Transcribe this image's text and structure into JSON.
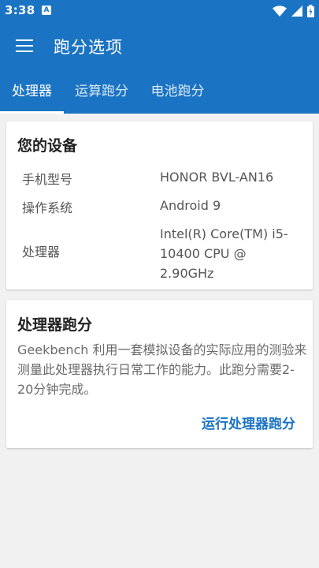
{
  "status_bar": {
    "time": "3:38",
    "notification_icon": "A",
    "icons": [
      "wifi-icon",
      "signal-icon",
      "battery-icon"
    ]
  },
  "app_bar": {
    "title": "跑分选项",
    "menu_icon": "hamburger-menu-icon"
  },
  "tabs": [
    {
      "label": "处理器",
      "active": true
    },
    {
      "label": "运算跑分",
      "active": false
    },
    {
      "label": "电池跑分",
      "active": false
    }
  ],
  "device_card": {
    "title": "您的设备",
    "rows": [
      {
        "label": "手机型号",
        "value": "HONOR BVL-AN16"
      },
      {
        "label": "操作系统",
        "value": "Android 9"
      },
      {
        "label": "处理器",
        "value": "Intel(R) Core(TM) i5-10400 CPU @ 2.90GHz"
      }
    ]
  },
  "benchmark_card": {
    "title": "处理器跑分",
    "description": "Geekbench 利用一套模拟设备的实际应用的测验来测量此处理器执行日常工作的能力。此跑分需要2-20分钟完成。",
    "action_label": "运行处理器跑分"
  },
  "colors": {
    "primary": "#1b74c3",
    "background": "#f1f1f1",
    "card": "#ffffff"
  }
}
